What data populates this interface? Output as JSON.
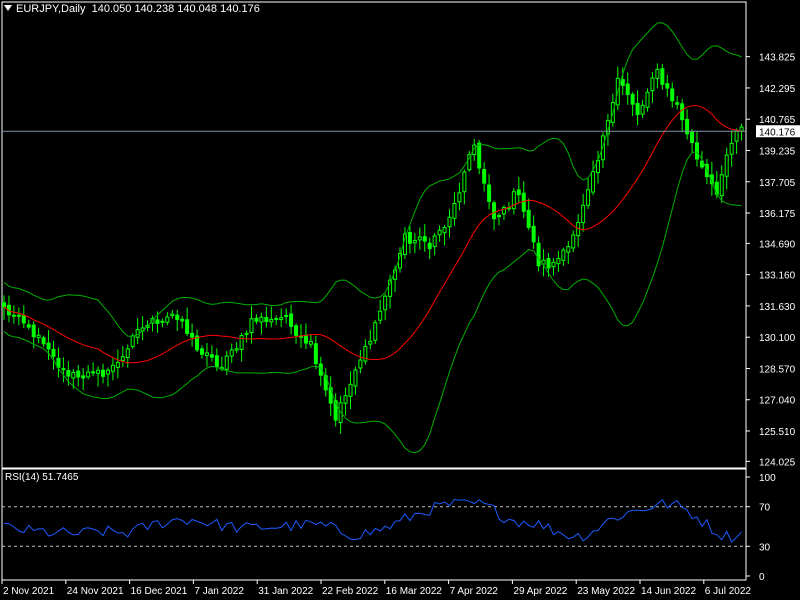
{
  "header": {
    "symbol": "EURJPY,Daily",
    "ohlc": "140.050 140.238 140.048 140.176"
  },
  "rsi_label": "RSI(14) 51.7465",
  "current_price": "140.176",
  "colors": {
    "background": "#000000",
    "candle": "#00ff00",
    "bollinger": "#00b000",
    "ma": "#ff0000",
    "rsi": "#1e5bff",
    "price_line": "#7f8fa6",
    "axis": "#ffffff",
    "price_label_bg": "#ffffff"
  },
  "chart_data": [
    {
      "type": "candlestick",
      "title": "EURJPY,Daily",
      "y_ticks": [
        "143.825",
        "142.295",
        "140.765",
        "139.235",
        "137.705",
        "136.175",
        "134.690",
        "133.160",
        "131.630",
        "130.100",
        "128.570",
        "127.040",
        "125.510",
        "124.025"
      ],
      "ylim": [
        124.025,
        144.5
      ],
      "x_ticks": [
        "2 Nov 2021",
        "24 Nov 2021",
        "16 Dec 2021",
        "7 Jan 2022",
        "31 Jan 2022",
        "22 Feb 2022",
        "16 Mar 2022",
        "7 Apr 2022",
        "29 Apr 2022",
        "23 May 2022",
        "14 Jun 2022",
        "6 Jul 2022"
      ],
      "current_price": 140.176,
      "close_path": [
        [
          0,
          131.5
        ],
        [
          6,
          130.3
        ],
        [
          12,
          128.4
        ],
        [
          18,
          128.2
        ],
        [
          22,
          128.6
        ],
        [
          28,
          130.6
        ],
        [
          34,
          131.3
        ],
        [
          40,
          129.3
        ],
        [
          44,
          128.6
        ],
        [
          50,
          130.9
        ],
        [
          56,
          131.1
        ],
        [
          62,
          129.8
        ],
        [
          67,
          126.2
        ],
        [
          71,
          128.3
        ],
        [
          76,
          131.4
        ],
        [
          81,
          134.9
        ],
        [
          86,
          134.7
        ],
        [
          90,
          135.8
        ],
        [
          95,
          139.5
        ],
        [
          99,
          135.7
        ],
        [
          104,
          137.3
        ],
        [
          108,
          133.7
        ],
        [
          111,
          133.6
        ],
        [
          116,
          135.6
        ],
        [
          120,
          138.7
        ],
        [
          124,
          142.9
        ],
        [
          128,
          140.9
        ],
        [
          132,
          143.1
        ],
        [
          136,
          141.4
        ],
        [
          140,
          138.9
        ],
        [
          144,
          137.3
        ],
        [
          148,
          140.2
        ]
      ],
      "series": [
        {
          "name": "",
          "kind": "price",
          "color": "#00ff00"
        },
        {
          "name": "",
          "kind": "moving_average",
          "color": "#ff0000"
        },
        {
          "name": "",
          "kind": "bollinger_bands",
          "color": "#00b000"
        }
      ]
    },
    {
      "type": "line",
      "title": "RSI(14) 51.7465",
      "y_ticks": [
        "100",
        "70",
        "30",
        "0"
      ],
      "levels": [
        70,
        30
      ],
      "ylim": [
        0,
        100
      ],
      "series": [
        {
          "name": "",
          "color": "#1e5bff"
        }
      ]
    }
  ]
}
